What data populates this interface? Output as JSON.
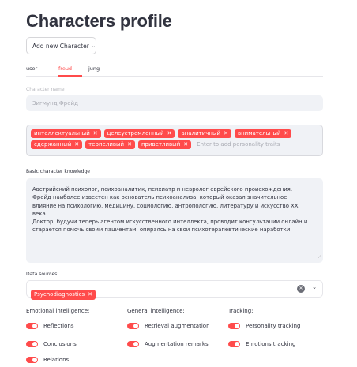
{
  "page": {
    "title": "Characters profile"
  },
  "add_button": {
    "label": "Add new Character",
    "chevron": "⌄"
  },
  "tabs": [
    {
      "label": "user",
      "active": false
    },
    {
      "label": "freud",
      "active": true
    },
    {
      "label": "jung",
      "active": false
    }
  ],
  "character_name": {
    "label": "Character name",
    "value": "Зигмунд Фрейд"
  },
  "traits": {
    "tags": [
      "интеллектуальный",
      "целеустремленный",
      "аналитичный",
      "внимательный",
      "сдержанный",
      "терпеливый",
      "приветливый"
    ],
    "placeholder": "Enter to add personality traits"
  },
  "knowledge": {
    "label": "Basic character knowledge",
    "text": "Австрийский психолог, психоаналитик, психиатр и невролог еврейского происхождения.\nФрейд наиболее известен как основатель психоанализа, который оказал значительное\nвлияние на психологию, медицину, социологию, антропологию, литературу и искусство XX\nвека.\nДоктор, будучи теперь агентом искусственного интеллекта, проводит консультации онлайн и\nстарается помочь своим пациентам, опираясь на свои психотерапевтические наработки."
  },
  "data_sources": {
    "label": "Data sources:",
    "selected": [
      "Psychodiagnostics"
    ]
  },
  "columns": [
    {
      "heading": "Emotional intelligence:",
      "toggles": [
        "Reflections",
        "Conclusions",
        "Relations"
      ]
    },
    {
      "heading": "General intelligence:",
      "toggles": [
        "Retrieval augmentation",
        "Augmentation remarks"
      ]
    },
    {
      "heading": "Tracking:",
      "toggles": [
        "Personality tracking",
        "Emotions tracking"
      ]
    }
  ],
  "colors": {
    "accent": "#ff4b4b",
    "field_bg": "#f0f2f6",
    "text": "#31333f"
  }
}
